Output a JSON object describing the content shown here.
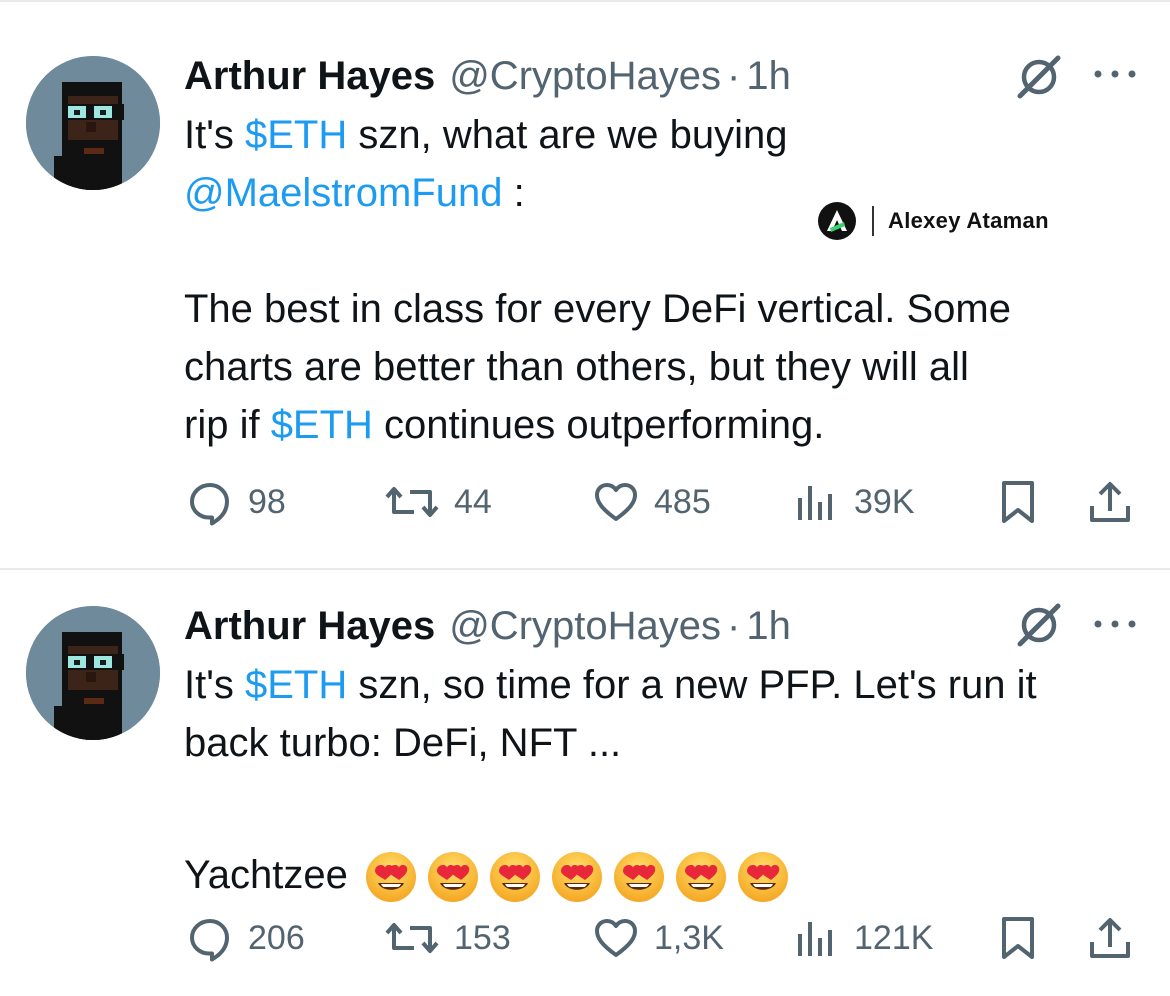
{
  "tweets": [
    {
      "author": "Arthur Hayes",
      "handle": "@CryptoHayes",
      "separator": "·",
      "time": "1h",
      "text": {
        "l1_a": "It's ",
        "l1_link": "$ETH",
        "l1_b": " szn, what are we buying",
        "l2_link": "@MaelstromFund",
        "l2_b": " :",
        "l4": "The best in class for every DeFi vertical. Some",
        "l5": "charts are better than others, but they will all",
        "l6_a": "rip if ",
        "l6_link": "$ETH",
        "l6_b": " continues outperforming."
      },
      "embedded_logo_text": "Alexey Ataman",
      "stats": {
        "replies": "98",
        "reposts": "44",
        "likes": "485",
        "views": "39K"
      }
    },
    {
      "author": "Arthur Hayes",
      "handle": "@CryptoHayes",
      "separator": "·",
      "time": "1h",
      "text": {
        "l1_a": "It's ",
        "l1_link": "$ETH",
        "l1_b": " szn, so time for a new PFP. Let's run it",
        "l2": "back turbo: DeFi, NFT ...",
        "l4": "Yachtzee"
      },
      "emoji_count": 7,
      "emoji_name": "smiling-face-with-heart-eyes",
      "stats": {
        "replies": "206",
        "reposts": "153",
        "likes": "1,3K",
        "views": "121K"
      }
    }
  ],
  "icons": {
    "reply": "reply-icon",
    "repost": "repost-icon",
    "like": "like-icon",
    "views": "views-icon",
    "bookmark": "bookmark-icon",
    "share": "share-icon",
    "grok": "grok-icon",
    "more": "more-icon"
  },
  "colors": {
    "link": "#1d9bf0",
    "secondary": "#536471",
    "text": "#0f1419",
    "avatar_bg": "#6e8a9b"
  }
}
